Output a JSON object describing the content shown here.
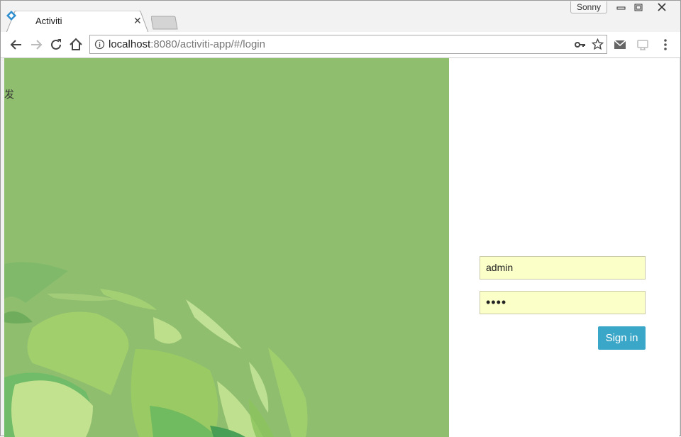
{
  "browser": {
    "tab_title": "Activiti",
    "profile_name": "Sonny",
    "url_host": "localhost",
    "url_path": ":8080/activiti-app/#/login",
    "icons": {
      "back": "arrow-left-icon",
      "forward": "arrow-right-icon",
      "reload": "reload-icon",
      "home": "home-icon",
      "info": "info-icon",
      "key": "key-icon",
      "star": "star-icon",
      "mail": "mail-icon",
      "cast": "cast-icon",
      "menu": "menu-icon"
    }
  },
  "page": {
    "corner_char": "发",
    "username_value": "admin",
    "password_value": "••••",
    "signin_label": "Sign in",
    "colors": {
      "panel_green": "#8fbe6f",
      "field_yellow": "#fbffc8",
      "button_blue": "#3aa6c8"
    }
  }
}
